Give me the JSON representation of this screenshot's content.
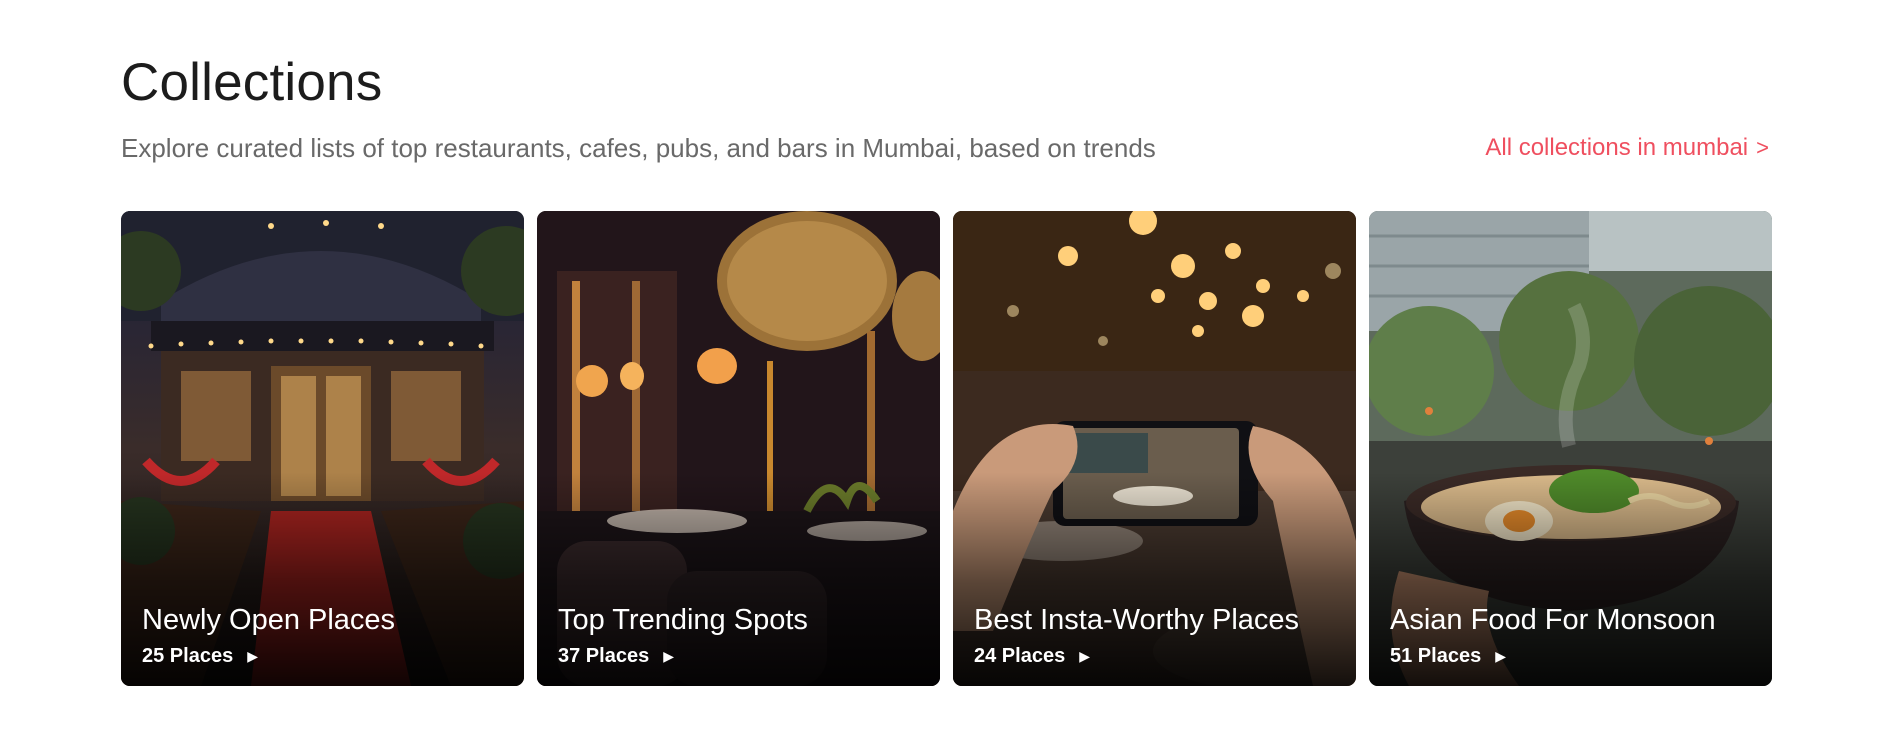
{
  "header": {
    "title": "Collections",
    "subtitle": "Explore curated lists of top restaurants, cafes, pubs, and bars in Mumbai, based on trends",
    "all_link": "All collections in mumbai",
    "all_link_chevron": ">"
  },
  "cards": [
    {
      "name": "Newly Open Places",
      "count": "25 Places"
    },
    {
      "name": "Top Trending Spots",
      "count": "37 Places"
    },
    {
      "name": "Best Insta-Worthy Places",
      "count": "24 Places"
    },
    {
      "name": "Asian Food For Monsoon",
      "count": "51 Places"
    }
  ],
  "colors": {
    "accent": "#ef4f5f",
    "title": "#1c1c1c",
    "subtitle": "#696969"
  },
  "icons": {
    "card_arrow": "caret-right-icon"
  }
}
